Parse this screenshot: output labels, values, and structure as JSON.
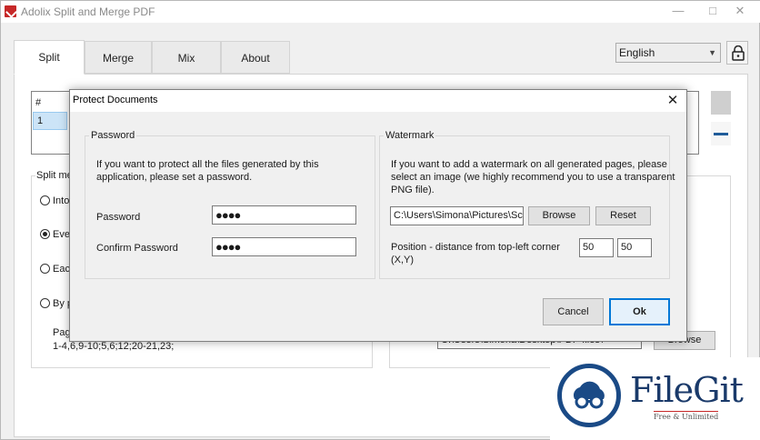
{
  "app": {
    "title": "Adolix Split and Merge PDF"
  },
  "tabs": [
    {
      "label": "Split"
    },
    {
      "label": "Merge"
    },
    {
      "label": "Mix"
    },
    {
      "label": "About"
    }
  ],
  "language": {
    "selected": "English"
  },
  "background": {
    "table_header": "#",
    "table_row": "1",
    "split_method_label": "Split met",
    "radio_options": [
      "Into",
      "Ever",
      "Each",
      "By pa"
    ],
    "selected_radio_index": 1,
    "pages_label": "Page",
    "pages_value": "1-4,6,9-10;5,6;12;20-21,23;",
    "output_path": "C:\\Users\\Simona\\Desktop\\PDF-files\\",
    "browse_label": "Browse"
  },
  "dialog": {
    "title": "Protect Documents",
    "password_group": {
      "label": "Password",
      "description_line1": "If you want to protect all the files generated by this",
      "description_line2": "application, please set a password.",
      "password_label": "Password",
      "password_value": "●●●●",
      "confirm_label": "Confirm Password",
      "confirm_value": "●●●●"
    },
    "watermark_group": {
      "label": "Watermark",
      "description_line1": "If you want to add a watermark on all generated pages, please",
      "description_line2": "select an image (we highly recommend you to use a transparent",
      "description_line3": "PNG file).",
      "image_path": "C:\\Users\\Simona\\Pictures\\Scree",
      "browse_label": "Browse",
      "reset_label": "Reset",
      "position_label_line1": "Position - distance from top-left corner",
      "position_label_line2": "(X,Y)",
      "x_value": "50",
      "y_value": "50"
    },
    "cancel_label": "Cancel",
    "ok_label": "Ok"
  },
  "watermark": {
    "brand": "FileGit",
    "tagline": "Free & Unlimited"
  },
  "colors": {
    "accent": "#0078d7",
    "brand": "#1a4a86"
  }
}
